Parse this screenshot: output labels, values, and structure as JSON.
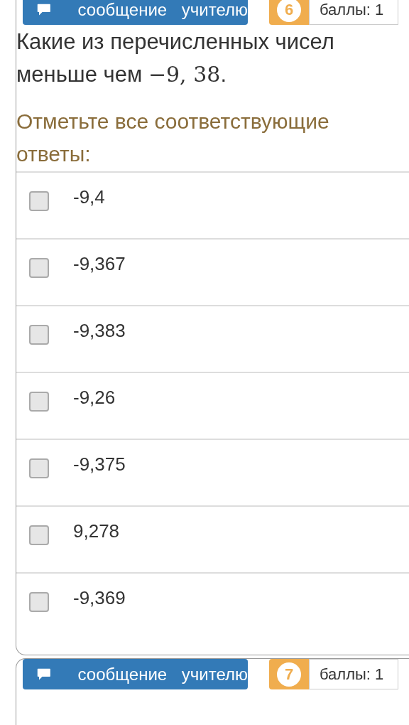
{
  "top_question": {
    "message_button": {
      "label": "сообщение учителю"
    },
    "number": "6",
    "points": "баллы: 1"
  },
  "question": {
    "text": "Какие из перечисленных чисел меньше чем",
    "math": "−9, 38",
    "end": "."
  },
  "prompt": "Отметьте все соответствующие ответы:",
  "options": [
    {
      "label": "-9,4",
      "checked": false
    },
    {
      "label": "-9,367",
      "checked": false
    },
    {
      "label": "-9,383",
      "checked": false
    },
    {
      "label": "-9,26",
      "checked": false
    },
    {
      "label": "-9,375",
      "checked": false
    },
    {
      "label": "9,278",
      "checked": false
    },
    {
      "label": "-9,369",
      "checked": false
    }
  ],
  "next_question": {
    "message_button": {
      "label": "сообщение учителю"
    },
    "number": "7",
    "points": "баллы: 1"
  }
}
